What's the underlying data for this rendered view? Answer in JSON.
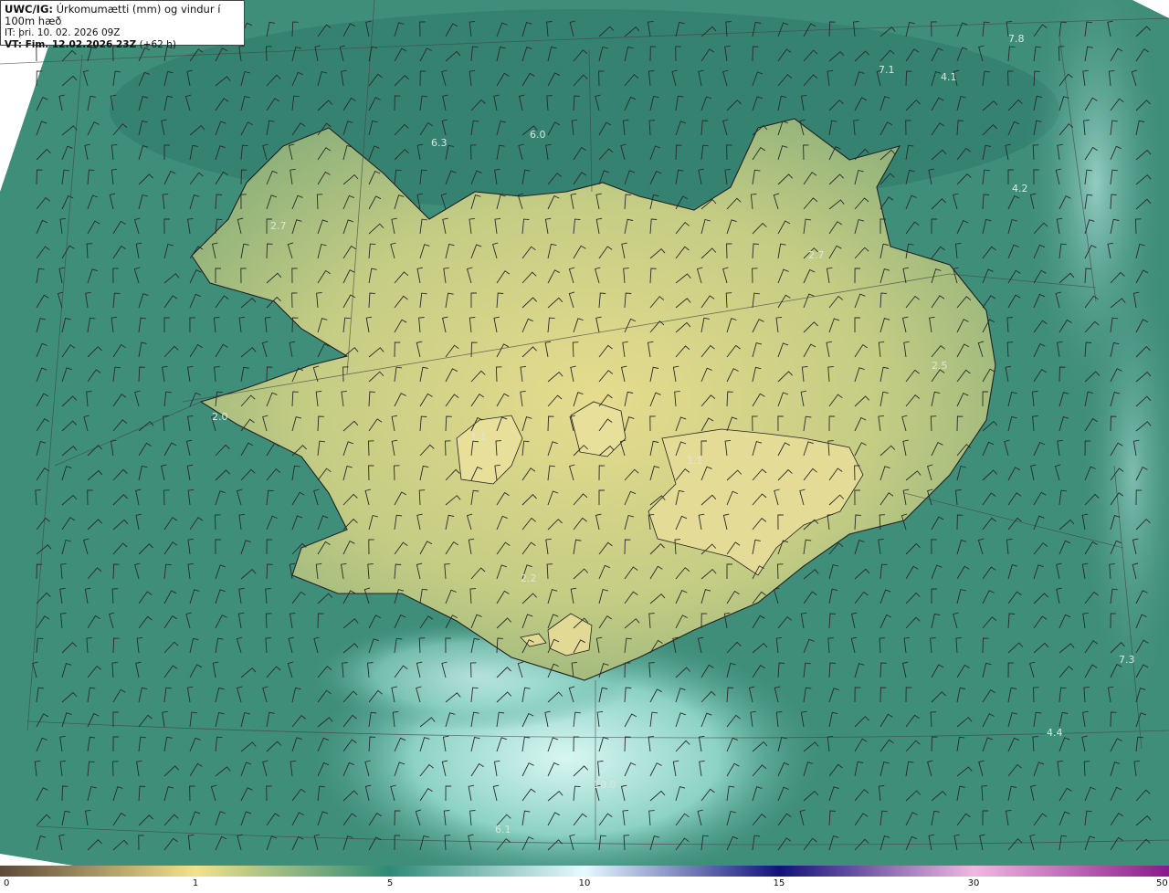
{
  "header": {
    "title_strong": "UWC/IG:",
    "title_rest": " Úrkomumætti (mm) og vindur í 100m hæð",
    "init_time": "IT: þri. 10. 02. 2026 09Z",
    "valid_strong": "VT: Fim. 12.02.2026 23Z",
    "valid_rest": " (+62 h)"
  },
  "colorbar": {
    "ticks": [
      "0",
      "1",
      "5",
      "10",
      "15",
      "30",
      "50"
    ],
    "colors": {
      "c0": "#5c4a3a",
      "c1": "#f2e28c",
      "c5": "#2e8a76",
      "c10": "#e6faff",
      "c15": "#12127a",
      "c30": "#f0b8e0",
      "c50": "#8a1a8a"
    }
  },
  "map": {
    "colors": {
      "sea": "#3f8e7a",
      "sea_dark": "#2f7868",
      "land_low": "#b8c880",
      "land_high": "#e2dc8c",
      "plume": "#b8ece4",
      "coast": "#222222"
    },
    "labels": [
      "7.8",
      "7.1",
      "4.1",
      "6.3",
      "6.0",
      "4.2",
      "2.7",
      "2.7",
      "2.5",
      "1.1",
      "1.1",
      "2.2",
      "2.0",
      "7.3",
      "4.4",
      "10.0",
      "6.1"
    ]
  }
}
